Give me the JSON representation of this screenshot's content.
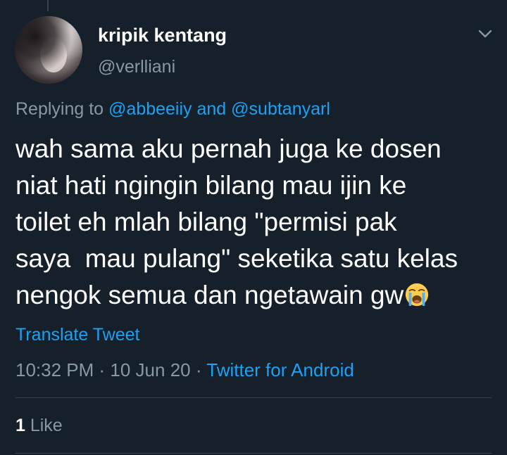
{
  "author": {
    "display_name": "kripik kentang",
    "handle": "@verlliani"
  },
  "reply": {
    "prefix": "Replying to ",
    "user1": "@abbeeiiy",
    "joiner": " and ",
    "user2": "@subtanyarl"
  },
  "tweet": {
    "lines": [
      "wah sama aku pernah juga ke dosen",
      "niat hati ngingin bilang mau ijin ke",
      "toilet eh mlah bilang \"permisi pak",
      "saya  mau pulang\" seketika satu kelas",
      "nengok semua dan ngetawain gw"
    ],
    "trailing_emoji": "loudly-crying-face-emoji"
  },
  "translate_label": "Translate Tweet",
  "meta": {
    "time": "10:32 PM",
    "sep1": " · ",
    "date": "10 Jun 20",
    "sep2": " · ",
    "source": "Twitter for Android"
  },
  "stats": {
    "likes_count": "1",
    "likes_label": " Like"
  },
  "icons": {
    "menu": "chevron-down-icon"
  },
  "colors": {
    "background": "#15202b",
    "primary_text": "#ffffff",
    "secondary_text": "#8899a6",
    "link": "#1da1f2",
    "divider": "#38444d"
  }
}
